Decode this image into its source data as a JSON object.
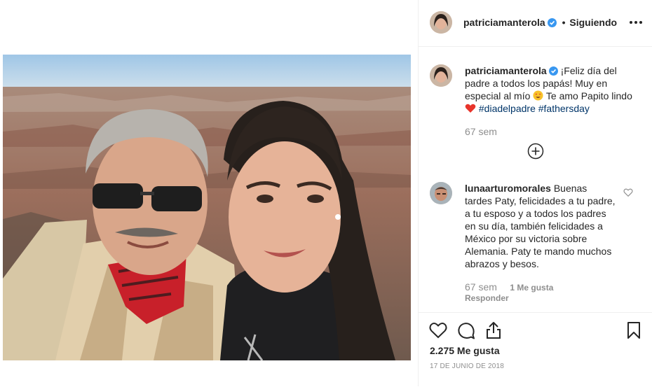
{
  "post": {
    "author": "patriciamanterola",
    "follow_separator": "•",
    "follow_status": "Siguiendo",
    "more_icon": "more-horizontal-icon"
  },
  "caption": {
    "author": "patriciamanterola",
    "text_before": "¡Feliz día del padre a todos los papás! Muy en especial al mío ",
    "text_middle": " Te amo Papito lindo ",
    "hashtags": [
      "#diadelpadre",
      "#fathersday"
    ],
    "emoji_1": "star-struck-emoji",
    "emoji_2": "heart-emoji",
    "time": "67 sem"
  },
  "load_more_icon": "plus-circle-icon",
  "comment": {
    "author": "lunaarturomorales",
    "text": "Buenas tardes Paty, felicidades a tu padre, a tu esposo y a todos los padres en su día, también felicidades a México por su victoria sobre Alemania. Paty te mando muchos abrazos y besos.",
    "time": "67 sem",
    "likes": "1 Me gusta",
    "reply": "Responder"
  },
  "actions": {
    "likes_count": "2.275 Me gusta",
    "date": "17 DE JUNIO DE 2018"
  },
  "colors": {
    "link": "#003569",
    "secondary": "#8e8e8e",
    "verified": "#3897f0",
    "border": "#efefef"
  }
}
